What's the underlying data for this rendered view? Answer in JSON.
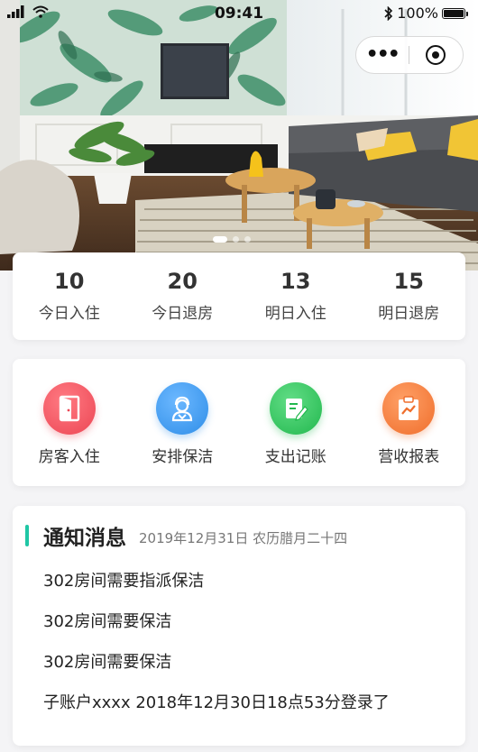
{
  "status_bar": {
    "time": "09:41",
    "battery": "100%"
  },
  "hero": {
    "active_slide": 1,
    "slide_count": 3
  },
  "stats": [
    {
      "value": "10",
      "label": "今日入住"
    },
    {
      "value": "20",
      "label": "今日退房"
    },
    {
      "value": "13",
      "label": "明日入住"
    },
    {
      "value": "15",
      "label": "明日退房"
    }
  ],
  "actions": [
    {
      "label": "房客入住",
      "icon": "door-icon",
      "color": "#f0555f"
    },
    {
      "label": "安排保洁",
      "icon": "cleaner-icon",
      "color": "#3a9af0"
    },
    {
      "label": "支出记账",
      "icon": "note-edit-icon",
      "color": "#2fc95c"
    },
    {
      "label": "营收报表",
      "icon": "report-icon",
      "color": "#f27c3c"
    }
  ],
  "notice": {
    "title": "通知消息",
    "date": "2019年12月31日 农历腊月二十四",
    "accent": "#1fc7a5",
    "items": [
      "302房间需要指派保洁",
      "302房间需要保洁",
      "302房间需要保洁",
      "子账户xxxx 2018年12月30日18点53分登录了"
    ]
  }
}
